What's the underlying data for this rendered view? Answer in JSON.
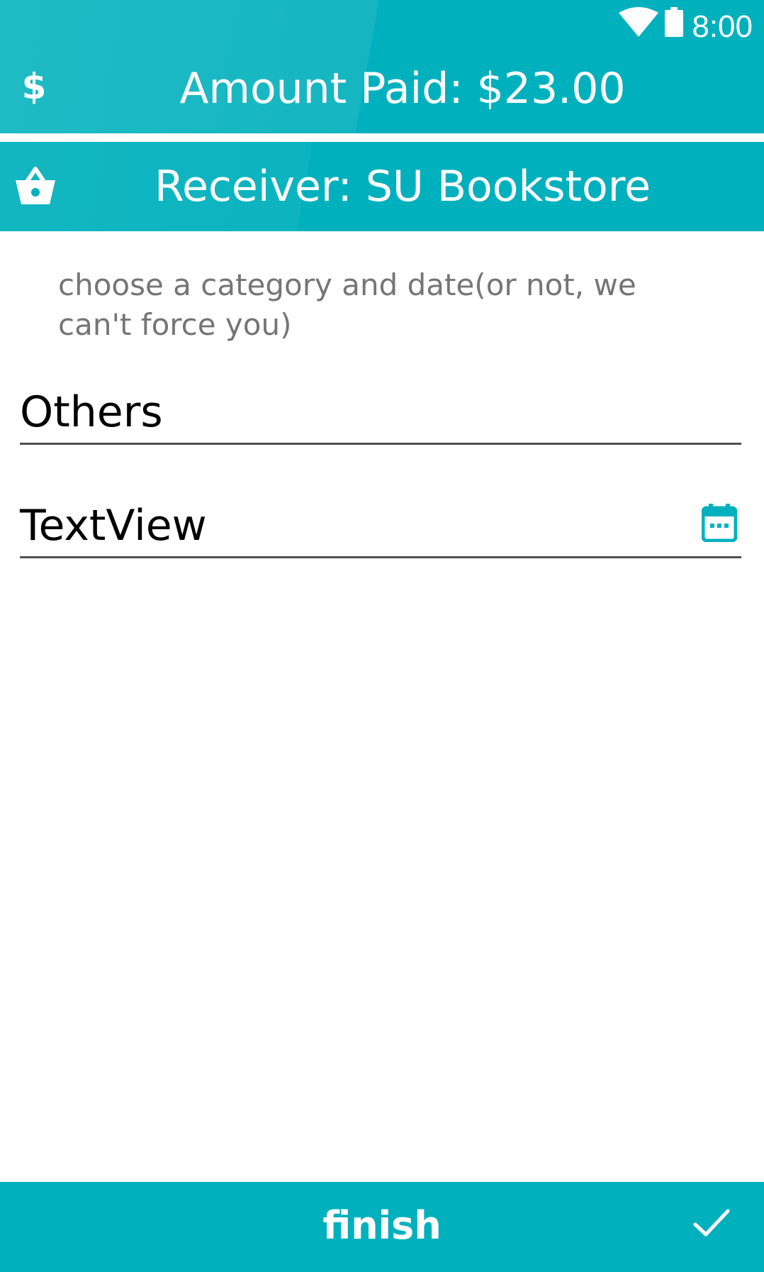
{
  "status_bar": {
    "time": "8:00",
    "wifi_icon": "wifi-icon",
    "battery_icon": "battery-icon"
  },
  "header": {
    "amount_label": "Amount Paid: $23.00",
    "amount_icon": "dollar-icon"
  },
  "receiver": {
    "label": "Receiver: SU Bookstore",
    "icon": "basket-icon"
  },
  "form": {
    "hint": "choose a category and date(or not, we can't force you)",
    "category_value": "Others",
    "date_value": "TextView",
    "date_icon": "calendar-icon"
  },
  "footer": {
    "finish_label": "finish",
    "finish_icon": "check-icon"
  },
  "colors": {
    "accent": "#00b1bd",
    "hint_text": "#757575",
    "underline": "#505050"
  }
}
